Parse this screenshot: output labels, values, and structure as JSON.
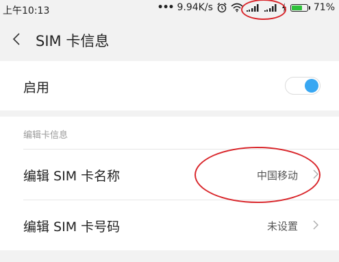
{
  "status_bar": {
    "time": "上午10:13",
    "dots": "•••",
    "speed": "9.94K/s",
    "battery_percent": "71%",
    "battery_level": 0.71,
    "icons": [
      "alarm-icon",
      "wifi-icon",
      "signal-icon",
      "signal-icon",
      "charging-icon",
      "battery-icon"
    ]
  },
  "header": {
    "title": "SIM  卡信息",
    "back_icon": "chevron-left-icon"
  },
  "enable_row": {
    "label": "启用",
    "toggle_on": true
  },
  "edit_section": {
    "header": "编辑卡信息",
    "items": [
      {
        "label": "编辑 SIM 卡名称",
        "value": "中国移动"
      },
      {
        "label": "编辑 SIM 卡号码",
        "value": "未设置"
      }
    ]
  },
  "colors": {
    "accent": "#38a7f2",
    "annotation": "#d9262b",
    "battery": "#2ec13a",
    "background": "#f2f2f2"
  }
}
